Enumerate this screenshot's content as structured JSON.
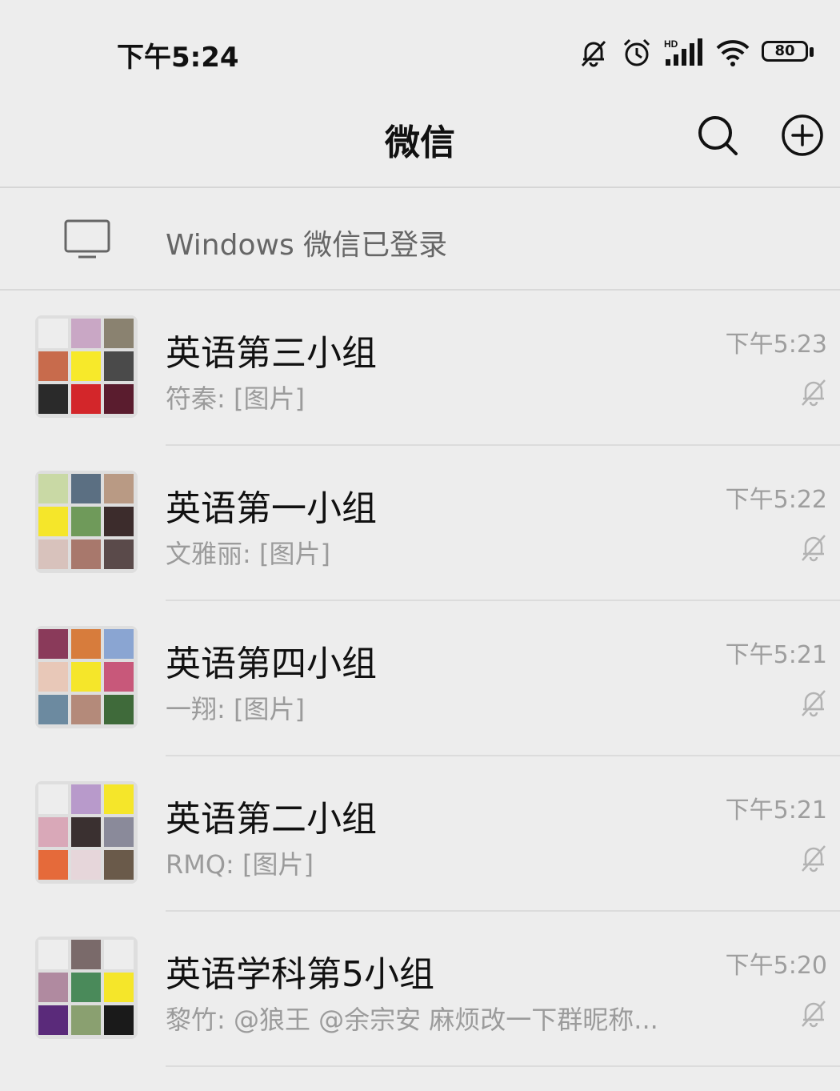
{
  "status_bar": {
    "time": "下午5:24",
    "network_label": "HD",
    "battery": "80"
  },
  "header": {
    "title": "微信"
  },
  "login_banner": {
    "text": "Windows 微信已登录"
  },
  "chats": [
    {
      "title": "英语第三小组",
      "preview": "符秦: [图片]",
      "time": "下午5:23",
      "muted": true,
      "avatar_colors": [
        "#ededed",
        "#c9a7c5",
        "#8a8270",
        "#c86b4c",
        "#f7e92a",
        "#4a4a4a",
        "#2a2a2a",
        "#d3262a",
        "#5a1c2e"
      ]
    },
    {
      "title": "英语第一小组",
      "preview": "文雅丽: [图片]",
      "time": "下午5:22",
      "muted": true,
      "avatar_colors": [
        "#c9d9a5",
        "#5b6f82",
        "#b99a84",
        "#f5e62a",
        "#6f9a5a",
        "#3c2c2c",
        "#d8c2bc",
        "#a8786c",
        "#5a4a4a"
      ]
    },
    {
      "title": "英语第四小组",
      "preview": "一翔: [图片]",
      "time": "下午5:21",
      "muted": true,
      "avatar_colors": [
        "#8a3a5a",
        "#d77c3c",
        "#8aa5d2",
        "#e8c8b8",
        "#f5e62a",
        "#c8587a",
        "#6c8aa0",
        "#b48a7a",
        "#3f6a3a"
      ]
    },
    {
      "title": "英语第二小组",
      "preview": "RMQ: [图片]",
      "time": "下午5:21",
      "muted": true,
      "avatar_colors": [
        "#ededed",
        "#b89acb",
        "#f5e62a",
        "#d9a8b8",
        "#3a3030",
        "#8a8a9a",
        "#e56a3a",
        "#e6d6da",
        "#6a5a4a"
      ]
    },
    {
      "title": "英语学科第5小组",
      "preview": "黎竹: @狼王 @余宗安 麻烦改一下群昵称...",
      "time": "下午5:20",
      "muted": true,
      "avatar_colors": [
        "#ededed",
        "#7a6a6a",
        "#ededed",
        "#b08aa0",
        "#4a8a5a",
        "#f5e62a",
        "#5a2a7a",
        "#8aa070",
        "#1a1a1a"
      ]
    }
  ]
}
